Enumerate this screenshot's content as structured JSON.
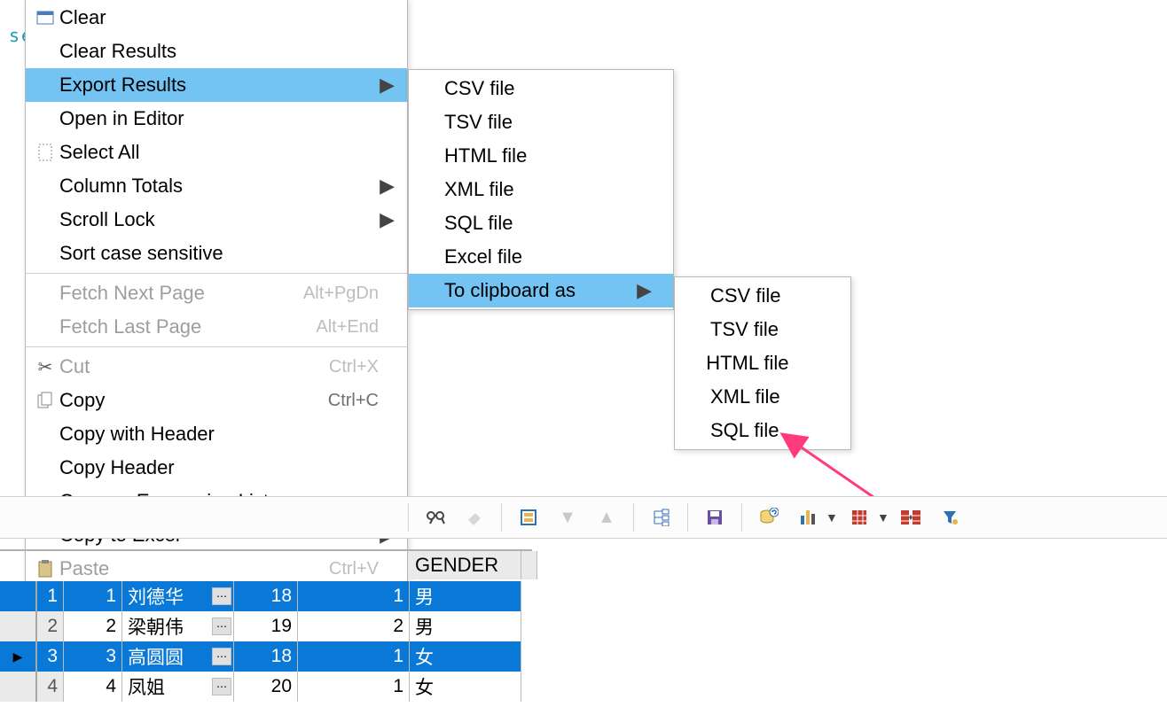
{
  "menu1": {
    "items": [
      {
        "label": "Clear",
        "icon": "window-icon"
      },
      {
        "label": "Clear Results"
      },
      {
        "label": "Export Results",
        "submenu": true,
        "highlight": true
      },
      {
        "label": "Open in Editor"
      },
      {
        "label": "Select All",
        "icon": "select-all-icon"
      },
      {
        "label": "Column Totals",
        "submenu": true
      },
      {
        "label": "Scroll Lock",
        "submenu": true
      },
      {
        "label": "Sort case sensitive"
      }
    ],
    "items2": [
      {
        "label": "Fetch Next Page",
        "accel": "Alt+PgDn",
        "disabled": true
      },
      {
        "label": "Fetch Last Page",
        "accel": "Alt+End",
        "disabled": true
      }
    ],
    "items3": [
      {
        "label": "Cut",
        "accel": "Ctrl+X",
        "icon": "scissors-icon",
        "disabled": true
      },
      {
        "label": "Copy",
        "accel": "Ctrl+C",
        "icon": "copy-icon"
      },
      {
        "label": "Copy with Header"
      },
      {
        "label": "Copy Header"
      },
      {
        "label": "Copy as Expression List"
      },
      {
        "label": "Copy to Excel",
        "submenu": true
      },
      {
        "label": "Paste",
        "accel": "Ctrl+V",
        "icon": "paste-icon",
        "disabled": true
      }
    ]
  },
  "menu2": {
    "items": [
      {
        "label": "CSV file"
      },
      {
        "label": "TSV file"
      },
      {
        "label": "HTML file"
      },
      {
        "label": "XML file"
      },
      {
        "label": "SQL file"
      },
      {
        "label": "Excel file"
      },
      {
        "label": "To clipboard as",
        "submenu": true,
        "highlight": true
      }
    ]
  },
  "menu3": {
    "items": [
      {
        "label": "CSV file"
      },
      {
        "label": "TSV file"
      },
      {
        "label": "HTML file"
      },
      {
        "label": "XML file"
      },
      {
        "label": "SQL file"
      }
    ]
  },
  "grid": {
    "header_visible": "GENDER",
    "rows": [
      {
        "n": 1,
        "id": 1,
        "name": "刘德华",
        "age": 18,
        "gid": 1,
        "gender": "男",
        "sel": true
      },
      {
        "n": 2,
        "id": 2,
        "name": "梁朝伟",
        "age": 19,
        "gid": 2,
        "gender": "男",
        "sel": false
      },
      {
        "n": 3,
        "id": 3,
        "name": "高圆圆",
        "age": 18,
        "gid": 1,
        "gender": "女",
        "sel": true,
        "current": true
      },
      {
        "n": 4,
        "id": 4,
        "name": "凤姐",
        "age": 20,
        "gid": 1,
        "gender": "女",
        "sel": false
      }
    ]
  },
  "sidebar_hint": "S",
  "toolbar_hint": "se"
}
